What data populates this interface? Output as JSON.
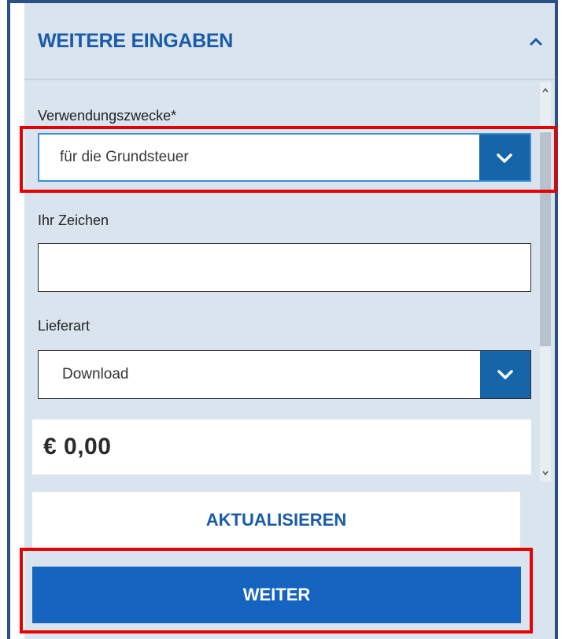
{
  "section": {
    "title": "WEITERE EINGABEN",
    "collapse_icon": "chevron-up-icon"
  },
  "form": {
    "purpose": {
      "label": "Verwendungszwecke*",
      "selected": "für die Grundsteuer",
      "dropdown_icon": "chevron-down-icon"
    },
    "reference": {
      "label": "Ihr Zeichen",
      "value": ""
    },
    "delivery": {
      "label": "Lieferart",
      "selected": "Download",
      "dropdown_icon": "chevron-down-icon"
    },
    "price": "€ 0,00"
  },
  "buttons": {
    "refresh": "AKTUALISIEREN",
    "next": "WEITER"
  },
  "colors": {
    "accent": "#1565c0",
    "header_text": "#1a5ba8",
    "panel_bg": "#d9e4ee",
    "highlight": "#e60000"
  }
}
